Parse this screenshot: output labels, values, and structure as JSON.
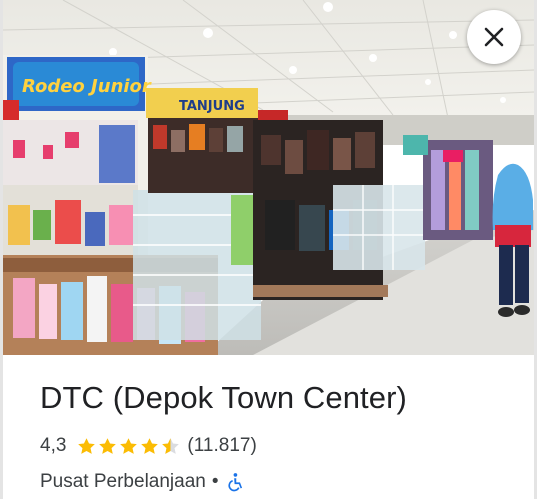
{
  "place": {
    "name": "DTC (Depok Town Center)",
    "rating": "4,3",
    "stars": 4.5,
    "review_count": "(11.817)",
    "category": "Pusat Perbelanjaan",
    "separator": "•"
  },
  "photo": {
    "signs": [
      "Rodeo Junior",
      "TANJUNG"
    ]
  },
  "icons": {
    "close": "close-icon",
    "accessibility": "wheelchair-accessible-icon",
    "star": "star-icon"
  },
  "colors": {
    "star": "#fbbc04",
    "accessibility": "#1a73e8",
    "text_primary": "#202124",
    "text_secondary": "#3c4043"
  }
}
